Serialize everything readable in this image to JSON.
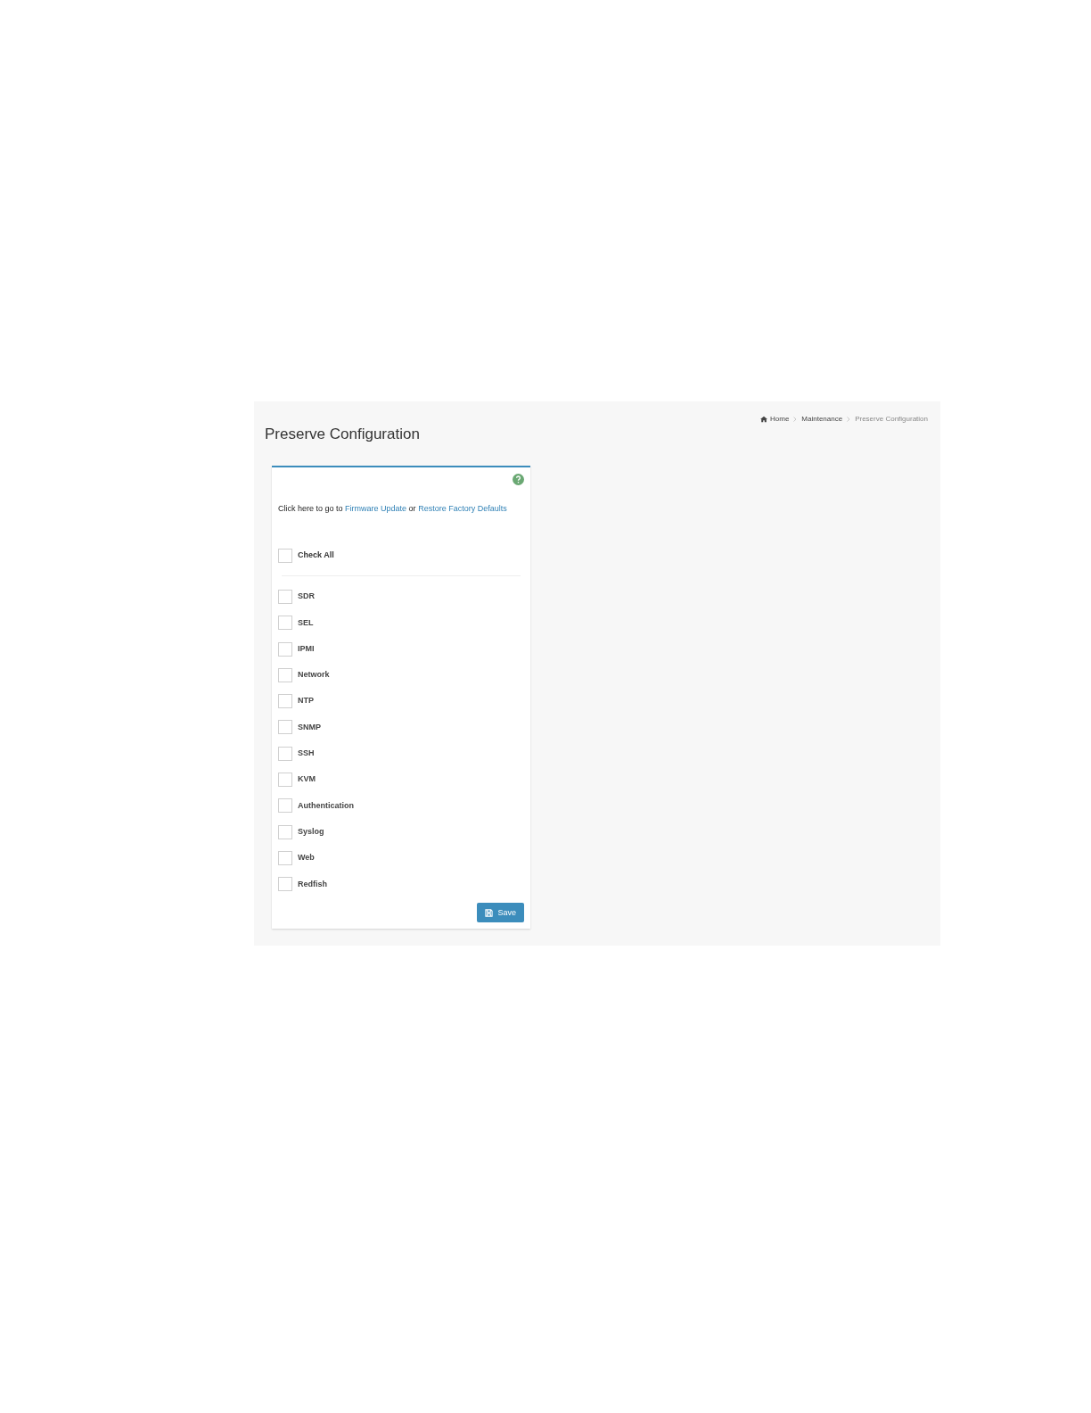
{
  "breadcrumb": [
    {
      "label": "Home",
      "kind": "home"
    },
    {
      "label": "Maintenance",
      "kind": "link"
    },
    {
      "label": "Preserve Configuration",
      "kind": "current"
    }
  ],
  "title": "Preserve Configuration",
  "intro": {
    "text": "Click here to go to",
    "link_1": "Firmware Update",
    "joiner": "or",
    "link_2": "Restore Factory Defaults"
  },
  "check_all": {
    "label": "Check All",
    "checked": false
  },
  "items": [
    {
      "label": "SDR",
      "checked": false
    },
    {
      "label": "SEL",
      "checked": false
    },
    {
      "label": "IPMI",
      "checked": false
    },
    {
      "label": "Network",
      "checked": false
    },
    {
      "label": "NTP",
      "checked": false
    },
    {
      "label": "SNMP",
      "checked": false
    },
    {
      "label": "SSH",
      "checked": false
    },
    {
      "label": "KVM",
      "checked": false
    },
    {
      "label": "Authentication",
      "checked": false
    },
    {
      "label": "Syslog",
      "checked": false
    },
    {
      "label": "Web",
      "checked": false
    },
    {
      "label": "Redfish",
      "checked": false
    }
  ],
  "save_button": "Save"
}
